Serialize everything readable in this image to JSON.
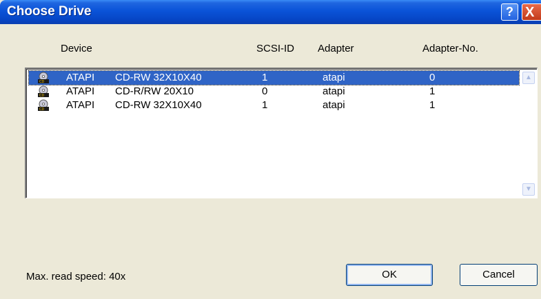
{
  "window": {
    "title": "Choose Drive",
    "help_glyph": "?",
    "close_glyph": "X"
  },
  "columns": {
    "device": "Device",
    "scsi_id": "SCSI-ID",
    "adapter": "Adapter",
    "adapter_no": "Adapter-No."
  },
  "drives": [
    {
      "vendor": "ATAPI",
      "model": "CD-RW 32X10X40",
      "scsi_id": "1",
      "adapter": "atapi",
      "adapter_no": "0",
      "selected": true,
      "icon": "cd-drive-icon"
    },
    {
      "vendor": "ATAPI",
      "model": "CD-R/RW 20X10",
      "scsi_id": "0",
      "adapter": "atapi",
      "adapter_no": "1",
      "selected": false,
      "icon": "cd-drive-icon"
    },
    {
      "vendor": "ATAPI",
      "model": "CD-RW 32X10X40",
      "scsi_id": "1",
      "adapter": "atapi",
      "adapter_no": "1",
      "selected": false,
      "icon": "cd-drive-icon"
    }
  ],
  "scrollbar": {
    "up_glyph": "▲",
    "down_glyph": "▼"
  },
  "status": {
    "max_read_speed": "Max. read speed: 40x"
  },
  "buttons": {
    "ok": "OK",
    "cancel": "Cancel"
  },
  "colors": {
    "titlebar": "#0a53d8",
    "selection": "#2f64c6",
    "dialog_bg": "#ece9d8"
  }
}
